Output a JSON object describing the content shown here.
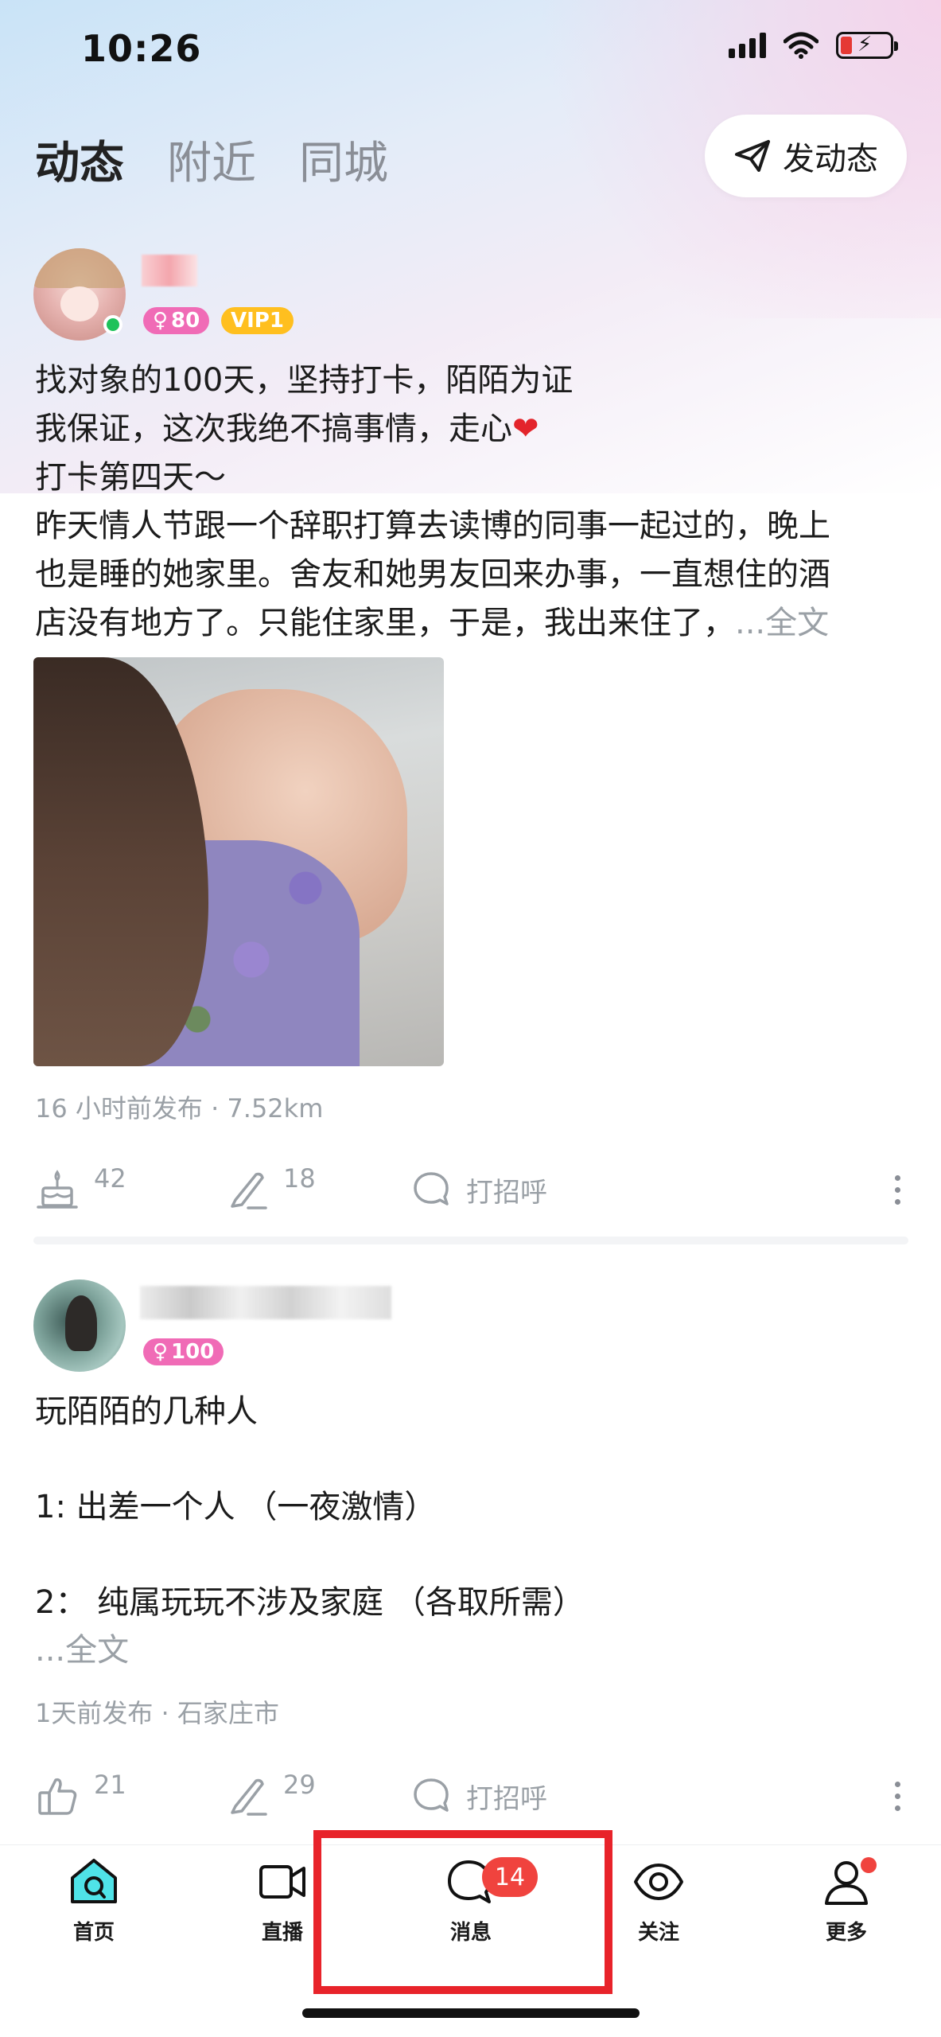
{
  "status_bar": {
    "time": "10:26"
  },
  "top_tabs": [
    {
      "label": "动态",
      "active": true
    },
    {
      "label": "附近",
      "active": false
    },
    {
      "label": "同城",
      "active": false
    }
  ],
  "post_button": {
    "label": "发动态"
  },
  "posts": [
    {
      "badges": {
        "level": "80",
        "vip": "VIP1"
      },
      "lines": [
        "找对象的100天，坚持打卡，陌陌为证",
        "我保证，这次我绝不搞事情，走心",
        "打卡第四天～",
        "昨天情人节跟一个辞职打算去读博的同事一起过的，晚上",
        "也是睡的她家里。舍友和她男友回来办事，一直想住的酒",
        "店没有地方了。只能住家里，于是，我出来住了，"
      ],
      "ellipsis": "...",
      "more": "全文",
      "meta": "16 小时前发布 · 7.52km",
      "actions": {
        "likes": "42",
        "comments": "18",
        "greet": "打招呼"
      }
    },
    {
      "badges": {
        "level": "100"
      },
      "lines": [
        "玩陌陌的几种人",
        "",
        "1:  出差一个人 （一夜激情）",
        "",
        "2：  纯属玩玩不涉及家庭 （各取所需）"
      ],
      "ellipsis": "...",
      "more": "全文",
      "meta": "1天前发布 · 石家庄市",
      "actions": {
        "likes": "21",
        "comments": "29",
        "greet": "打招呼"
      }
    }
  ],
  "bottom_nav": [
    {
      "label": "首页",
      "icon": "home-icon"
    },
    {
      "label": "直播",
      "icon": "video-camera-icon"
    },
    {
      "label": "消息",
      "icon": "chat-bubble-icon",
      "badge": "14"
    },
    {
      "label": "关注",
      "icon": "eye-icon"
    },
    {
      "label": "更多",
      "icon": "person-icon"
    }
  ],
  "colors": {
    "accent_pink": "#f06bb6",
    "vip_yellow": "#ffbf1f",
    "badge_red": "#f0433e",
    "highlight_red": "#e8232a",
    "online_green": "#1ec25a"
  }
}
